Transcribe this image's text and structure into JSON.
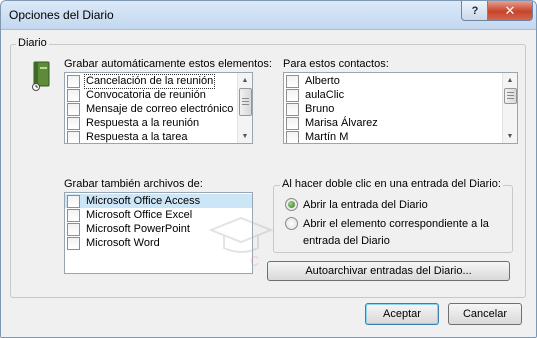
{
  "window": {
    "title": "Opciones del Diario",
    "help_glyph": "?",
    "close_glyph": "✕"
  },
  "diario_group": {
    "label": "Diario"
  },
  "auto_record": {
    "label": "Grabar automáticamente estos elementos:",
    "items": [
      {
        "label": "Cancelación de la reunión",
        "checked": false,
        "focused": true
      },
      {
        "label": "Convocatoria de reunión",
        "checked": false
      },
      {
        "label": "Mensaje de correo electrónico",
        "checked": false
      },
      {
        "label": "Respuesta a la reunión",
        "checked": false
      },
      {
        "label": "Respuesta a la tarea",
        "checked": false
      }
    ]
  },
  "contacts": {
    "label": "Para estos contactos:",
    "items": [
      {
        "label": "Alberto",
        "checked": false
      },
      {
        "label": "aulaClic",
        "checked": false
      },
      {
        "label": "Bruno",
        "checked": false
      },
      {
        "label": "Marisa Álvarez",
        "checked": false
      },
      {
        "label": "Martín M",
        "checked": false
      }
    ]
  },
  "files": {
    "label": "Grabar también archivos de:",
    "items": [
      {
        "label": "Microsoft Office Access",
        "checked": false,
        "selected": true
      },
      {
        "label": "Microsoft Office Excel",
        "checked": false
      },
      {
        "label": "Microsoft PowerPoint",
        "checked": false
      },
      {
        "label": "Microsoft Word",
        "checked": false
      }
    ]
  },
  "double_click": {
    "label": "Al hacer doble clic en una entrada del Diario:",
    "options": [
      {
        "label": "Abrir la entrada del Diario",
        "selected": true
      },
      {
        "label_line1": "Abrir el elemento correspondiente a la",
        "label_line2": "entrada del Diario",
        "selected": false
      }
    ]
  },
  "buttons": {
    "autoarchive": "Autoarchivar entradas del Diario...",
    "ok": "Aceptar",
    "cancel": "Cancelar"
  },
  "colors": {
    "selection": "#cde6f7",
    "dialog_bg": "#f0f0f0",
    "title_gradient_top": "#dbe9f8",
    "close_red": "#c7432a"
  }
}
